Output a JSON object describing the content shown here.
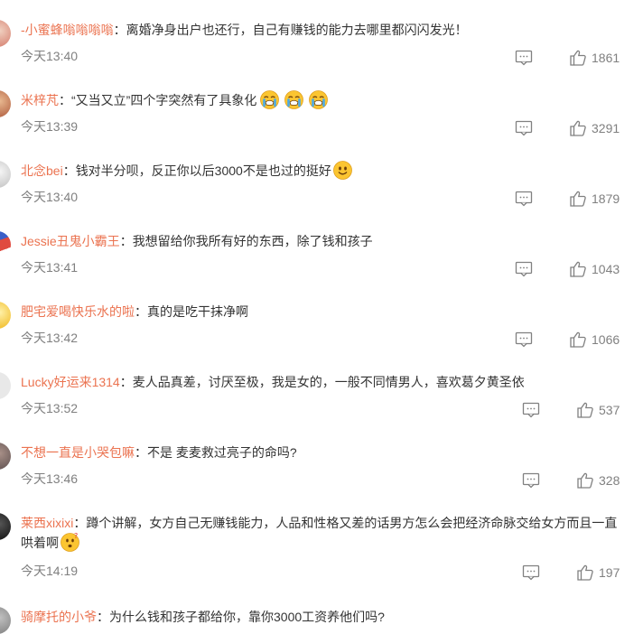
{
  "comments": [
    {
      "user": "-小蜜蜂嗡嗡嗡嗡",
      "sep": "：",
      "text": "离婚净身出户也还行，自己有赚钱的能力去哪里都闪闪发光！",
      "time": "今天13:40",
      "likes": "1861",
      "avatar_color": "#d98a7a",
      "emojis": []
    },
    {
      "user": "米梓芃",
      "sep": "：",
      "text": "“又当又立”四个字突然有了具象化",
      "time": "今天13:39",
      "likes": "3291",
      "avatar_color": "#b86a4a",
      "emojis": [
        "crying-face-icon",
        "crying-face-icon",
        "crying-face-icon"
      ]
    },
    {
      "user": "北念bei",
      "sep": "：",
      "text": "钱对半分呗，反正你以后3000不是也过的挺好",
      "time": "今天13:40",
      "likes": "1879",
      "avatar_color": "#c9c9c9",
      "emojis": [
        "smiley-face-icon"
      ]
    },
    {
      "user": "Jessie丑鬼小霸王",
      "sep": "：",
      "text": "我想留给你我所有好的东西，除了钱和孩子",
      "time": "今天13:41",
      "likes": "1043",
      "avatar_color": "#e04a3f",
      "emojis": []
    },
    {
      "user": "肥宅爱喝快乐水的啦",
      "sep": "：",
      "text": "真的是吃干抹净啊",
      "time": "今天13:42",
      "likes": "1066",
      "avatar_color": "#f2c033",
      "emojis": []
    },
    {
      "user": "Lucky好运来1314",
      "sep": "：",
      "text": "麦人品真差，讨厌至极，我是女的，一般不同情男人，喜欢葛夕黄圣依",
      "time": "今天13:52",
      "likes": "537",
      "avatar_color": "#e8e8e8",
      "emojis": []
    },
    {
      "user": "不想一直是小哭包嘛",
      "sep": "：",
      "text": "不是 麦麦救过亮子的命吗?",
      "time": "今天13:46",
      "likes": "328",
      "avatar_color": "#6a5a58",
      "emojis": []
    },
    {
      "user": "莱西xixixi",
      "sep": "：",
      "text": "蹲个讲解，女方自己无赚钱能力，人品和性格又差的话男方怎么会把经济命脉交给女方而且一直哄着啊",
      "time": "今天14:19",
      "likes": "197",
      "avatar_color": "#1a1a1a",
      "emojis": [
        "thinking-face-icon"
      ]
    },
    {
      "user": "骑摩托的小爷",
      "sep": "：",
      "text": "为什么钱和孩子都给你，靠你3000工资养他们吗?",
      "time": "",
      "likes": "",
      "avatar_color": "#8a8a8a",
      "emojis": []
    }
  ]
}
